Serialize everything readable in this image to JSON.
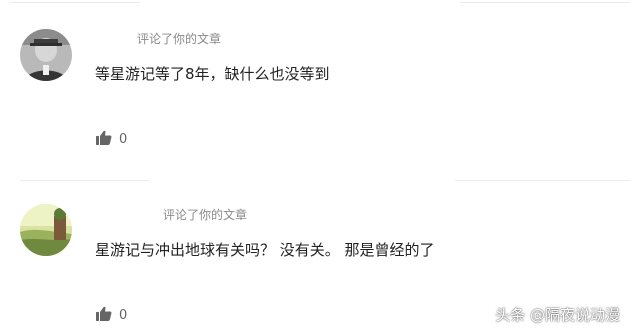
{
  "comments": [
    {
      "meta": "评论了你的文章",
      "text": "等星游记等了8年，缺什么也没等到",
      "likes": "0",
      "avatar_icon": "user-avatar-photo-grayscale"
    },
    {
      "meta": "评论了你的文章",
      "text": "星游记与冲出地球有关吗？ 没有关。 那是曾经的了",
      "likes": "0",
      "avatar_icon": "user-avatar-photo-landscape"
    }
  ],
  "icons": {
    "like": "thumbs-up-icon"
  },
  "watermark": "头条 @隔夜说动漫",
  "colors": {
    "meta_text": "#8a8a8a",
    "body_text": "#222222",
    "like_icon": "#666666",
    "divider": "#ececec"
  }
}
